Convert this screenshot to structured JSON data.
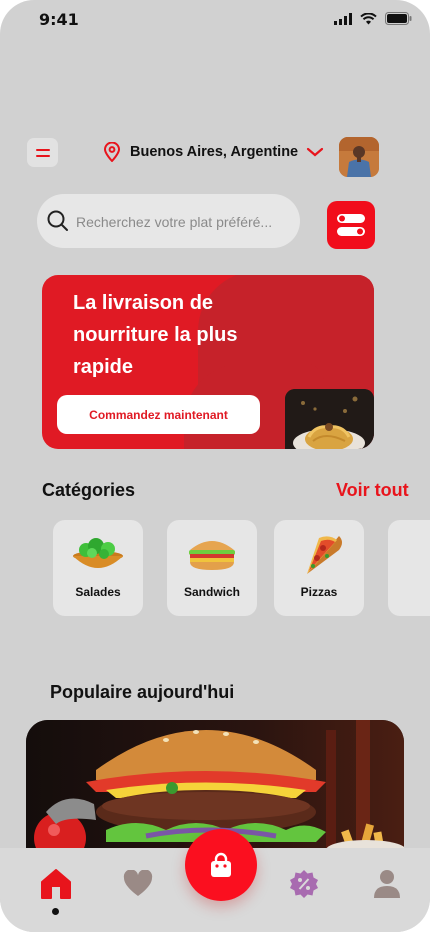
{
  "status": {
    "time": "9:41"
  },
  "header": {
    "location": "Buenos Aires,  Argentine"
  },
  "search": {
    "placeholder": "Recherchez votre plat préféré..."
  },
  "banner": {
    "title": "La livraison de nourriture la plus rapide",
    "cta": "Commandez maintenant"
  },
  "categories": {
    "title": "Catégories",
    "see_all": "Voir tout",
    "items": [
      {
        "label": "Salades",
        "icon": "salad-icon"
      },
      {
        "label": "Sandwich",
        "icon": "sandwich-icon"
      },
      {
        "label": "Pizzas",
        "icon": "pizza-icon"
      }
    ]
  },
  "popular": {
    "title": "Populaire aujourd'hui"
  },
  "nav": {
    "items": [
      "home-icon",
      "heart-icon",
      "shopping-bag-icon",
      "discount-icon",
      "user-icon"
    ],
    "active": "home-icon"
  },
  "colors": {
    "accent": "#e8141c",
    "background": "#d1d1d1"
  }
}
